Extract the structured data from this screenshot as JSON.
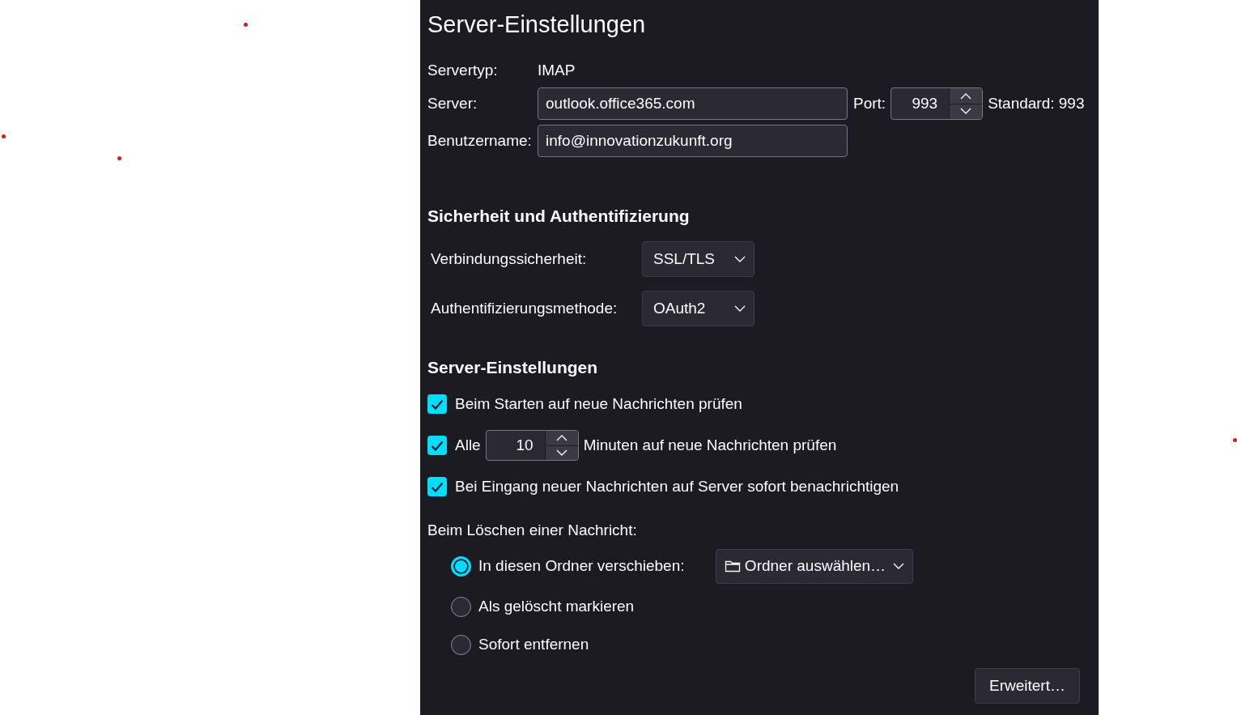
{
  "title": "Server-Einstellungen",
  "server_type": {
    "label": "Servertyp:",
    "value": "IMAP"
  },
  "server": {
    "label": "Server:",
    "value": "outlook.office365.com"
  },
  "port": {
    "label": "Port:",
    "value": "993",
    "default": "Standard: 993"
  },
  "username": {
    "label": "Benutzername:",
    "value": "info@innovationzukunft.org"
  },
  "security": {
    "heading": "Sicherheit und Authentifizierung",
    "fields": [
      {
        "label": "Verbindungssicherheit:",
        "value": "SSL/TLS"
      },
      {
        "label": "Authentifizierungsmethode:",
        "value": "OAuth2"
      }
    ]
  },
  "server_settings": {
    "heading": "Server-Einstellungen",
    "options": [
      {
        "kind": "check",
        "label": "Beim Starten auf neue Nachrichten prüfen",
        "checked": true
      },
      {
        "kind": "interval",
        "label": "Alle",
        "value": "10",
        "suffix": "Minuten auf neue Nachrichten prüfen",
        "checked": true
      },
      {
        "kind": "check",
        "label": "Bei Eingang neuer Nachrichten auf Server sofort benachrichtigen",
        "checked": true
      }
    ]
  },
  "delete": {
    "label": "Beim Löschen einer Nachricht:",
    "options": [
      {
        "label": "In diesen Ordner verschieben:",
        "selected": true,
        "folder_picker": "Ordner auswählen…"
      },
      {
        "label": "Als gelöscht markieren",
        "selected": false
      },
      {
        "label": "Sofort entfernen",
        "selected": false
      }
    ]
  },
  "advanced_button": "Erweitert…"
}
